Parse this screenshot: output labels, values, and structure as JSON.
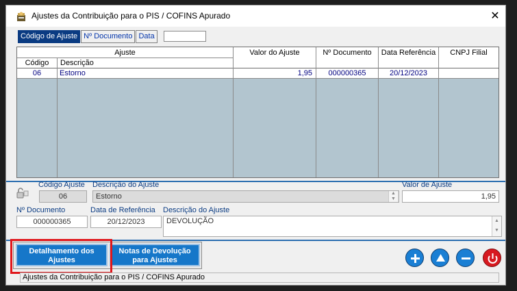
{
  "window": {
    "title": "Ajustes da Contribuição para o PIS / COFINS Apurado",
    "close_glyph": "✕"
  },
  "tabs": [
    {
      "label": "Código de Ajuste",
      "active": true
    },
    {
      "label": "Nº Documento",
      "active": false
    },
    {
      "label": "Data",
      "active": false
    }
  ],
  "tab_search_value": "",
  "grid": {
    "group_header": "Ajuste",
    "headers": {
      "codigo": "Código",
      "descricao": "Descrição",
      "valor": "Valor do Ajuste",
      "documento": "Nº Documento",
      "data": "Data Referência",
      "cnpj": "CNPJ Filial"
    },
    "rows": [
      {
        "codigo": "06",
        "descricao": "Estorno",
        "valor": "1,95",
        "documento": "000000365",
        "data": "20/12/2023",
        "cnpj": ""
      }
    ]
  },
  "detail": {
    "codigo_label": "Código Ajuste",
    "codigo_value": "06",
    "descricao_label": "Descrição do Ajuste",
    "descricao_value": "Estorno",
    "valor_label": "Valor de Ajuste",
    "valor_value": "1,95",
    "documento_label": "Nº Documento",
    "documento_value": "000000365",
    "data_label": "Data de Referência",
    "data_value": "20/12/2023",
    "descricao2_label": "Descrição do Ajuste",
    "descricao2_value": "DEVOLUÇÃO"
  },
  "buttons": {
    "detalhamento": [
      "Detalhamento dos",
      "Ajustes"
    ],
    "notas": [
      "Notas de Devolução",
      "para Ajustes"
    ],
    "add_icon": "plus-icon",
    "up_icon": "arrow-up-icon",
    "remove_icon": "minus-icon",
    "exit_icon": "power-icon"
  },
  "colors": {
    "accent": "#0a3b82",
    "button_blue": "#1677c9",
    "grid_bg": "#b2c5cf",
    "exit_red": "#d71920",
    "highlight": "#e0161b"
  },
  "statusbar": {
    "text": "Ajustes da Contribuição para o PIS / COFINS Apurado"
  }
}
